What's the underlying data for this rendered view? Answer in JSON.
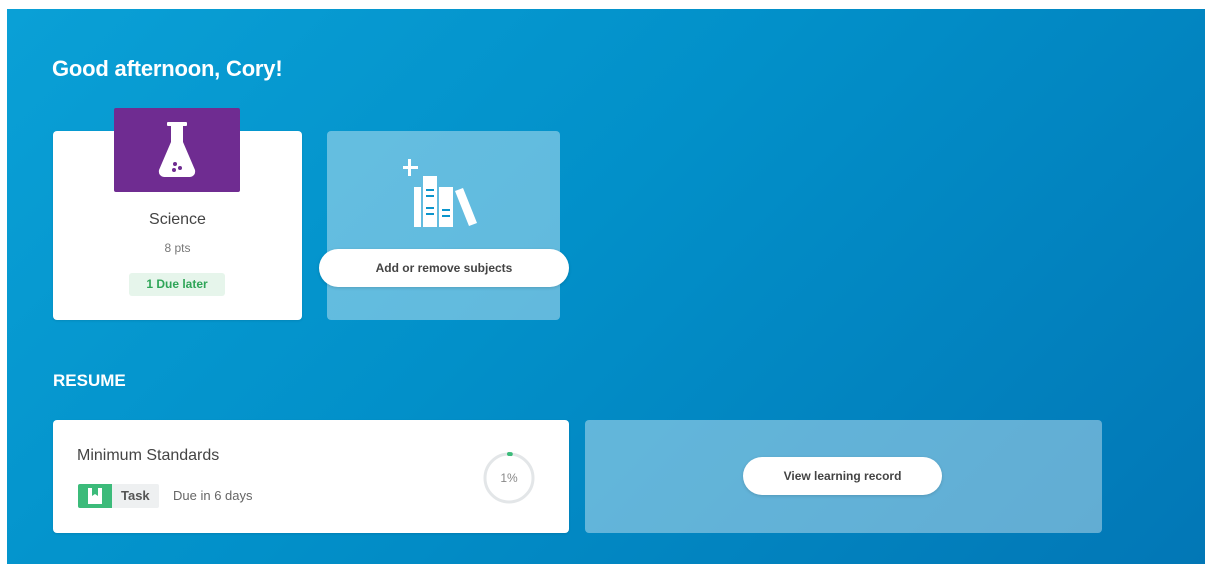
{
  "greeting": "Good afternoon, Cory!",
  "subjects": [
    {
      "name": "Science",
      "points": "8 pts",
      "due_badge": "1 Due later",
      "tile_color": "#6f2c91",
      "icon": "flask-icon"
    }
  ],
  "add_subjects": {
    "button_label": "Add or remove subjects",
    "icon": "add-books-icon"
  },
  "resume": {
    "heading": "RESUME",
    "item": {
      "title": "Minimum Standards",
      "type_label": "Task",
      "type_icon": "task-icon",
      "due_text": "Due in 6 days",
      "progress_label": "1%",
      "progress_value": 0.01
    },
    "record_button_label": "View learning record"
  },
  "colors": {
    "background_start": "#0aa0d6",
    "background_end": "#0277b6",
    "due_badge_text": "#2fa558",
    "task_badge": "#3cbb7a"
  }
}
